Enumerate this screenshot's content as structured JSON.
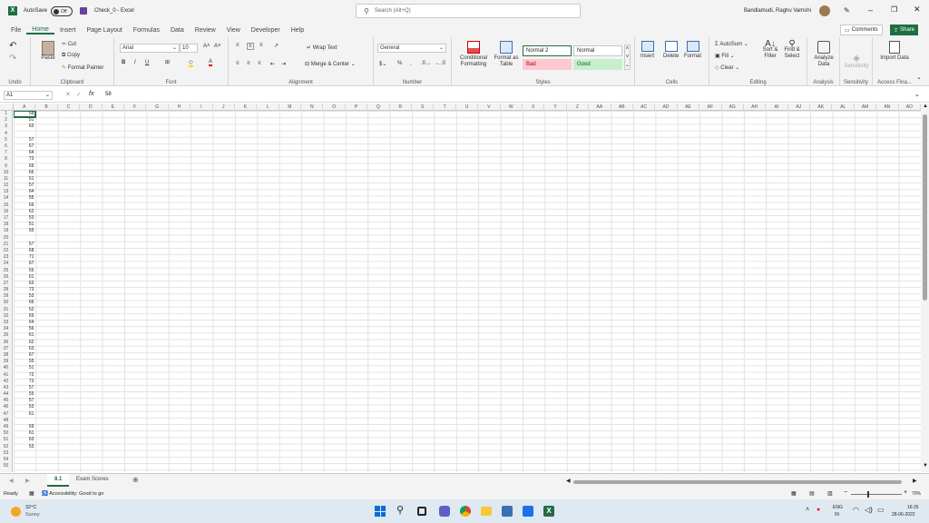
{
  "titlebar": {
    "app_icon": "excel-icon",
    "autosave_label": "AutoSave",
    "autosave_state": "Off",
    "save_icon": "save-icon",
    "doc_title": "Check_0 - Excel",
    "search_placeholder": "Search (Alt+Q)",
    "user_name": "Bandlamudi, Raghu Vamshi"
  },
  "menu": {
    "tabs": [
      "File",
      "Home",
      "Insert",
      "Page Layout",
      "Formulas",
      "Data",
      "Review",
      "View",
      "Developer",
      "Help"
    ],
    "active": "Home",
    "comments": "Comments",
    "share": "Share"
  },
  "ribbon": {
    "undo": {
      "label": "Undo"
    },
    "clipboard": {
      "paste": "Paste",
      "cut": "Cut",
      "copy": "Copy",
      "format_painter": "Format Painter",
      "label": "Clipboard"
    },
    "font": {
      "name": "Arial",
      "size": "10",
      "label": "Font"
    },
    "alignment": {
      "wrap": "Wrap Text",
      "merge": "Merge & Center",
      "label": "Alignment"
    },
    "number": {
      "format": "General",
      "label": "Number"
    },
    "styles": {
      "conditional": "Conditional Formatting",
      "format_table": "Format as Table",
      "normal2": "Normal 2",
      "normal": "Normal",
      "bad": "Bad",
      "good": "Good",
      "label": "Styles"
    },
    "cells": {
      "insert": "Insert",
      "delete": "Delete",
      "format": "Format",
      "label": "Cells"
    },
    "editing": {
      "autosum": "AutoSum",
      "fill": "Fill",
      "clear": "Clear",
      "sort": "Sort & Filter",
      "find": "Find & Select",
      "label": "Editing"
    },
    "analysis": {
      "analyze": "Analyze Data",
      "label": "Analysis"
    },
    "sensitivity": {
      "btn": "Sensitivity",
      "label": "Sensitivity"
    },
    "access": {
      "btn": "Import Data",
      "label": "Access Fina..."
    }
  },
  "formula": {
    "namebox": "A1",
    "fx": "fx",
    "value": "58"
  },
  "columns": [
    "A",
    "B",
    "C",
    "D",
    "E",
    "F",
    "G",
    "H",
    "I",
    "J",
    "K",
    "L",
    "M",
    "N",
    "O",
    "P",
    "Q",
    "R",
    "S",
    "T",
    "U",
    "V",
    "W",
    "X",
    "Y",
    "Z",
    "AA",
    "AB",
    "AC",
    "AD",
    "AE",
    "AF",
    "AG",
    "AH",
    "AI",
    "AJ",
    "AK",
    "AL",
    "AM",
    "AN",
    "AO"
  ],
  "rows": [
    "1",
    "2",
    "3",
    "4",
    "5",
    "6",
    "7",
    "8",
    "9",
    "10",
    "11",
    "12",
    "13",
    "14",
    "15",
    "16",
    "17",
    "18",
    "19",
    "20",
    "21",
    "22",
    "23",
    "24",
    "25",
    "26",
    "27",
    "28",
    "29",
    "30",
    "31",
    "32",
    "33",
    "34",
    "35",
    "36",
    "37",
    "38",
    "39",
    "40",
    "41",
    "42",
    "43",
    "44",
    "45",
    "46",
    "47",
    "48",
    "49",
    "50",
    "51",
    "52",
    "53",
    "54",
    "55"
  ],
  "col_a_values": [
    "58",
    "51",
    "63",
    "",
    "57",
    "67",
    "64",
    "73",
    "69",
    "66",
    "51",
    "57",
    "64",
    "55",
    "69",
    "62",
    "53",
    "51",
    "55",
    "",
    "57",
    "68",
    "71",
    "67",
    "55",
    "61",
    "63",
    "73",
    "53",
    "66",
    "52",
    "69",
    "64",
    "56",
    "61",
    "62",
    "63",
    "67",
    "55",
    "51",
    "72",
    "73",
    "57",
    "55",
    "57",
    "53",
    "61",
    "",
    "69",
    "61",
    "63",
    "53",
    ""
  ],
  "sheets": [
    {
      "name": "8.1",
      "active": true
    },
    {
      "name": "Exam Scores",
      "active": false
    }
  ],
  "status": {
    "ready": "Ready",
    "accessibility": "Accessibility: Good to go",
    "zoom": "70%"
  },
  "taskbar": {
    "temp": "32°C",
    "weather": "Sunny",
    "lang1": "ENG",
    "lang2": "IN",
    "time": "16:26",
    "date": "28-06-2022"
  }
}
